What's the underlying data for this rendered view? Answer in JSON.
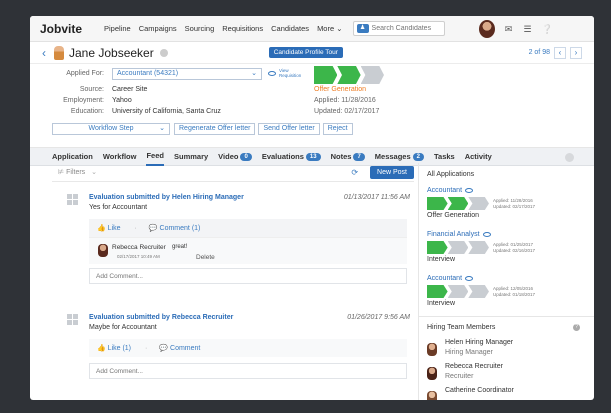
{
  "nav": {
    "logo": "Jobvite",
    "items": [
      "Pipeline",
      "Campaigns",
      "Sourcing",
      "Requisitions",
      "Candidates",
      "More ⌄"
    ],
    "search_placeholder": "Search Candidates"
  },
  "header": {
    "name": "Jane Jobseeker",
    "tour_button": "Candidate Profile Tour",
    "pager": "2 of 98"
  },
  "details": {
    "applied_for_label": "Applied For:",
    "applied_for_value": "Accountant (54321)",
    "view_requisition": "View Requisition",
    "source_label": "Source:",
    "source_value": "Career Site",
    "employment_label": "Employment:",
    "employment_value": "Yahoo",
    "education_label": "Education:",
    "education_value": "University of California, Santa Cruz",
    "stage": "Offer Generation",
    "applied": "Applied: 11/28/2016",
    "updated": "Updated: 02/17/2017",
    "stage_progress": {
      "complete": 2,
      "total": 3
    },
    "workflow_step": "Workflow Step",
    "buttons": [
      "Regenerate Offer letter",
      "Send Offer letter",
      "Reject"
    ]
  },
  "tabs": [
    {
      "label": "Application",
      "badge": ""
    },
    {
      "label": "Workflow",
      "badge": ""
    },
    {
      "label": "Feed",
      "badge": ""
    },
    {
      "label": "Summary",
      "badge": ""
    },
    {
      "label": "Video",
      "badge": "0"
    },
    {
      "label": "Evaluations",
      "badge": "13"
    },
    {
      "label": "Notes",
      "badge": "7"
    },
    {
      "label": "Messages",
      "badge": "2"
    },
    {
      "label": "Tasks",
      "badge": ""
    },
    {
      "label": "Activity",
      "badge": ""
    }
  ],
  "feed": {
    "filters": "Filters",
    "new_post": "New Post",
    "posts": [
      {
        "title": "Evaluation submitted by Helen Hiring Manager",
        "subtitle": "Yes for Accountant",
        "date": "01/13/2017 11:56 AM",
        "like": "Like",
        "comment": "Comment (1)",
        "comment_author": "Rebecca Recruiter",
        "comment_text": "great!",
        "comment_time": "02/17/2017 10:49 AM",
        "delete": "Delete",
        "add_comment": "Add Comment..."
      },
      {
        "title": "Evaluation submitted by Rebecca Recruiter",
        "subtitle": "Maybe for Accountant",
        "date": "01/26/2017 9:56 AM",
        "like": "Like (1)",
        "comment": "Comment",
        "add_comment": "Add Comment..."
      }
    ]
  },
  "sidebar": {
    "all_applications": "All Applications",
    "applications": [
      {
        "title": "Accountant",
        "applied": "Applied: 11/28/2016",
        "updated": "Updated: 02/17/2017",
        "status": "Offer Generation",
        "complete": 2,
        "total": 3
      },
      {
        "title": "Financial Analyst",
        "applied": "Applied: 01/25/2017",
        "updated": "Updated: 02/16/2017",
        "status": "Interview",
        "complete": 1,
        "total": 3
      },
      {
        "title": "Accountant",
        "applied": "Applied: 12/05/2016",
        "updated": "Updated: 01/18/2017",
        "status": "Interview",
        "complete": 1,
        "total": 3
      }
    ],
    "team_title": "Hiring Team Members",
    "members": [
      {
        "name": "Helen Hiring Manager",
        "role": "Hiring Manager"
      },
      {
        "name": "Rebecca Recruiter",
        "role": "Recruiter"
      },
      {
        "name": "Catherine Coordinator",
        "role": ""
      }
    ]
  },
  "colors": {
    "accent": "#2b6cb7",
    "stage_done": "#3cb64a",
    "stage_pending": "#c9cdd2",
    "stage_text": "#ee7b21"
  }
}
